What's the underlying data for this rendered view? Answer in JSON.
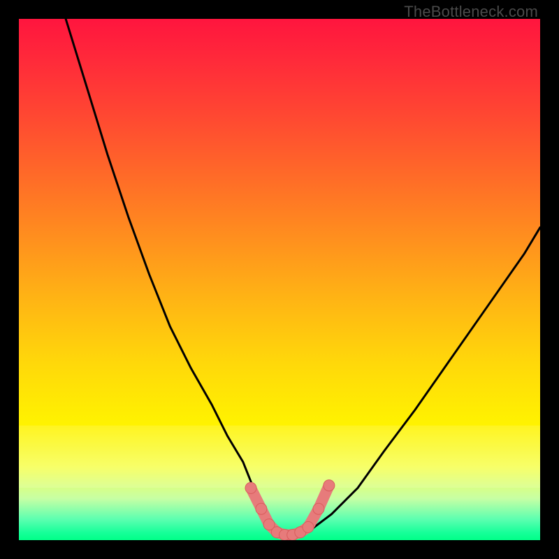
{
  "watermark": "TheBottleneck.com",
  "colors": {
    "frame": "#000000",
    "curve_stroke": "#000000",
    "marker_fill": "#e77b7b",
    "marker_stroke": "#d85c5c",
    "gradient_top": "#ff153e",
    "gradient_bottom": "#00ff88"
  },
  "chart_data": {
    "type": "line",
    "title": "",
    "xlabel": "",
    "ylabel": "",
    "xlim": [
      0,
      100
    ],
    "ylim": [
      0,
      100
    ],
    "grid": false,
    "legend": false,
    "annotations": [
      "TheBottleneck.com"
    ],
    "note": "Axes are unlabeled in the source image; x and y values are normalized 0–100 estimates read from pixel positions (origin bottom-left). Curve represents a bottleneck V-shape; markers cluster near the minimum.",
    "series": [
      {
        "name": "bottleneck-curve",
        "x": [
          9,
          13,
          17,
          21,
          25,
          29,
          33,
          37,
          40,
          43,
          45,
          47,
          49,
          51,
          53,
          56,
          60,
          65,
          70,
          76,
          83,
          90,
          97,
          100
        ],
        "y": [
          100,
          87,
          74,
          62,
          51,
          41,
          33,
          26,
          20,
          15,
          10,
          6,
          3,
          1,
          1,
          2,
          5,
          10,
          17,
          25,
          35,
          45,
          55,
          60
        ]
      }
    ],
    "markers": {
      "name": "highlighted-points",
      "x": [
        44.5,
        46.5,
        48.0,
        49.5,
        51.0,
        52.5,
        54.0,
        55.5,
        57.5,
        59.5
      ],
      "y": [
        10.0,
        6.0,
        3.0,
        1.5,
        1.0,
        1.0,
        1.5,
        2.5,
        6.0,
        10.5
      ]
    }
  }
}
